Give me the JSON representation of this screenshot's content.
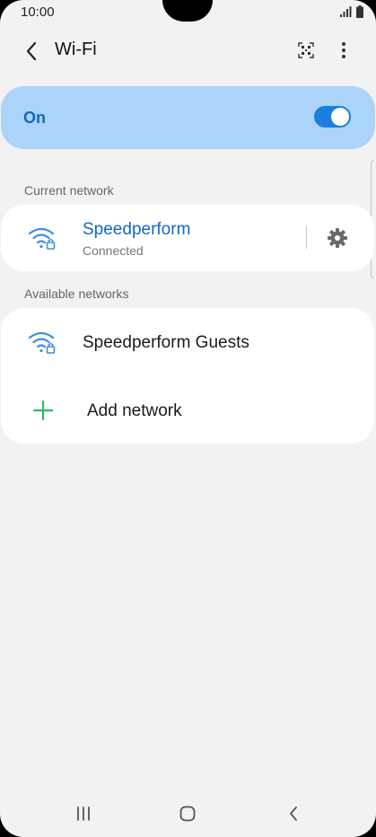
{
  "status_bar": {
    "time": "10:00"
  },
  "header": {
    "title": "Wi-Fi"
  },
  "toggle": {
    "label": "On",
    "state": "on",
    "accent_color": "#1a7fe0",
    "card_color": "#acd3f9"
  },
  "current_network": {
    "section_label": "Current network",
    "name": "Speedperform",
    "status": "Connected",
    "name_color": "#1467c4"
  },
  "available_networks": {
    "section_label": "Available networks",
    "items": [
      {
        "name": "Speedperform Guests"
      }
    ],
    "add_label": "Add network",
    "add_icon_color": "#2fb86a"
  },
  "icons": {
    "back": "chevron-left-icon",
    "qr": "qr-code-icon",
    "more": "more-vertical-icon",
    "wifi_locked": "wifi-lock-icon",
    "settings": "gear-icon",
    "add": "plus-icon",
    "nav_recents": "recents-icon",
    "nav_home": "home-icon",
    "nav_back": "back-icon"
  }
}
